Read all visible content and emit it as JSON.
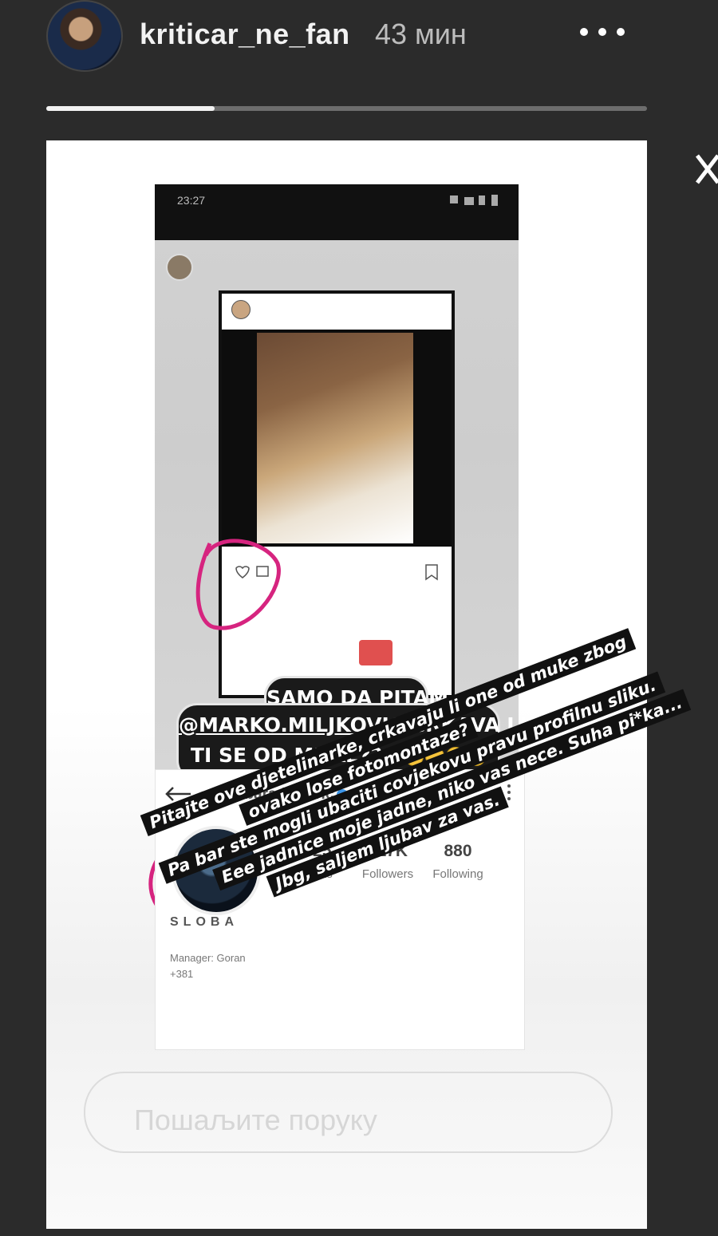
{
  "header": {
    "username": "kriticar_ne_fan",
    "time": "43 мин",
    "more_icon": "more-dots-icon",
    "progress": 0.28
  },
  "close_icon": "close-icon",
  "story": {
    "phone_time": "23:27",
    "reshared_post": {
      "username": "",
      "link_text": ""
    },
    "tag_line1": "SAMO DA PITAM",
    "tag_mention": "@MARKO.MILJKOVIC",
    "tag_after": "CRKAVA LI",
    "tag_line3": "TI SE OD MUKE??",
    "profile": {
      "username": "slobaradanovic",
      "posts_value": "325",
      "posts_label": "Posts",
      "followers_value": "317K",
      "followers_label": "Followers",
      "following_value": "880",
      "following_label": "Following",
      "name": "SLOBA",
      "bio1": "Manager: Goran",
      "bio2": "+381"
    },
    "rotated_lines": [
      "Pitajte ove djetelinarke, crkavaju li one od muke zbog",
      "ovako lose fotomontaze?",
      "Pa bar ste mogli ubaciti covjekovu pravu profilnu sliku.",
      "Eee jadnice moje jadne, niko vas nece. Suha pi*ka...",
      "Jbg, saljem ljubav za vas."
    ]
  },
  "message_placeholder": "Пошаљите поруку",
  "colors": {
    "background": "#2b2b2b",
    "circle_annotation": "#d6247f",
    "verified": "#3c95e8"
  }
}
